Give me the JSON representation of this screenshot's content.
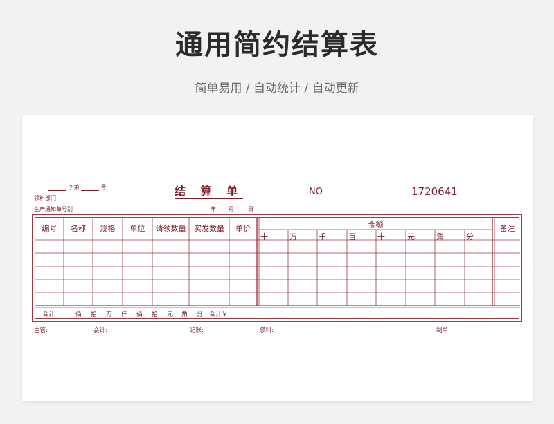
{
  "header": {
    "title": "通用简约结算表",
    "subtitle": "简单易用 / 自动统计 / 自动更新"
  },
  "form": {
    "zi_label": "字第",
    "hao_label": "号",
    "dept_label": "领料部门",
    "notice_label": "生产通知单号别",
    "title": "结 算 单",
    "no_label": "NO",
    "no_value": "1720641",
    "year": "年",
    "month": "月",
    "day": "日"
  },
  "table": {
    "columns": [
      "编号",
      "名称",
      "规格",
      "单位",
      "请领数量",
      "实发数量",
      "单价"
    ],
    "amount_label": "金额",
    "amount_units": [
      "十",
      "万",
      "千",
      "百",
      "十",
      "元",
      "角",
      "分"
    ],
    "remark_label": "备注",
    "footer": {
      "total": "合计",
      "units": [
        "佰",
        "拾",
        "万",
        "仟",
        "佰",
        "拾",
        "元",
        "角",
        "分"
      ],
      "total_yen": "合计￥"
    }
  },
  "signatures": [
    "主管:",
    "会计:",
    "记账:",
    "领料:",
    "制单:"
  ],
  "colors": {
    "accent": "#7a1f2b",
    "line": "#9c3a47",
    "background": "#f1f2f4"
  }
}
